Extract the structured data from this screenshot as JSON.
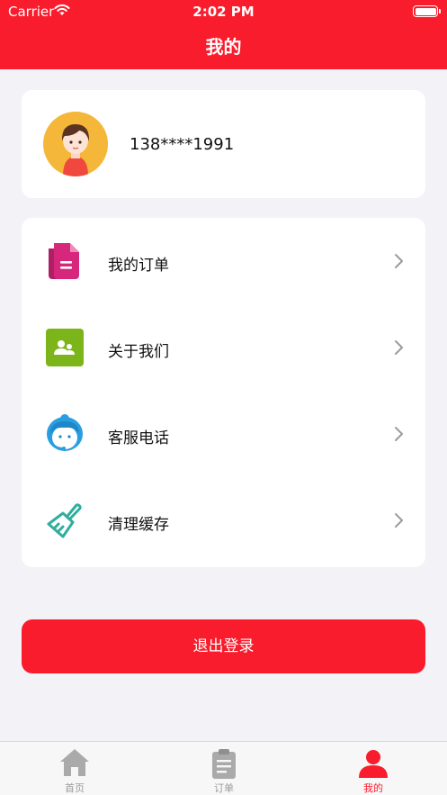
{
  "status_bar": {
    "carrier": "Carrier",
    "time": "2:02 PM"
  },
  "nav": {
    "title": "我的"
  },
  "profile": {
    "phone": "138****1991",
    "avatar_icon": "user-avatar-icon"
  },
  "menu": {
    "items": [
      {
        "label": "我的订单",
        "icon": "order-document-icon",
        "color": "#d6277c"
      },
      {
        "label": "关于我们",
        "icon": "about-us-icon",
        "color": "#7cb519"
      },
      {
        "label": "客服电话",
        "icon": "customer-service-icon",
        "color": "#2a9ee0"
      },
      {
        "label": "清理缓存",
        "icon": "broom-icon",
        "color": "#2fae9d"
      }
    ]
  },
  "logout": {
    "label": "退出登录"
  },
  "tabbar": {
    "tabs": [
      {
        "label": "首页",
        "icon": "home-icon",
        "active": false
      },
      {
        "label": "订单",
        "icon": "clipboard-icon",
        "active": false
      },
      {
        "label": "我的",
        "icon": "person-icon",
        "active": true
      }
    ]
  },
  "colors": {
    "accent": "#f91c2c",
    "background": "#f2f2f7",
    "inactive": "#9a9a9a"
  }
}
